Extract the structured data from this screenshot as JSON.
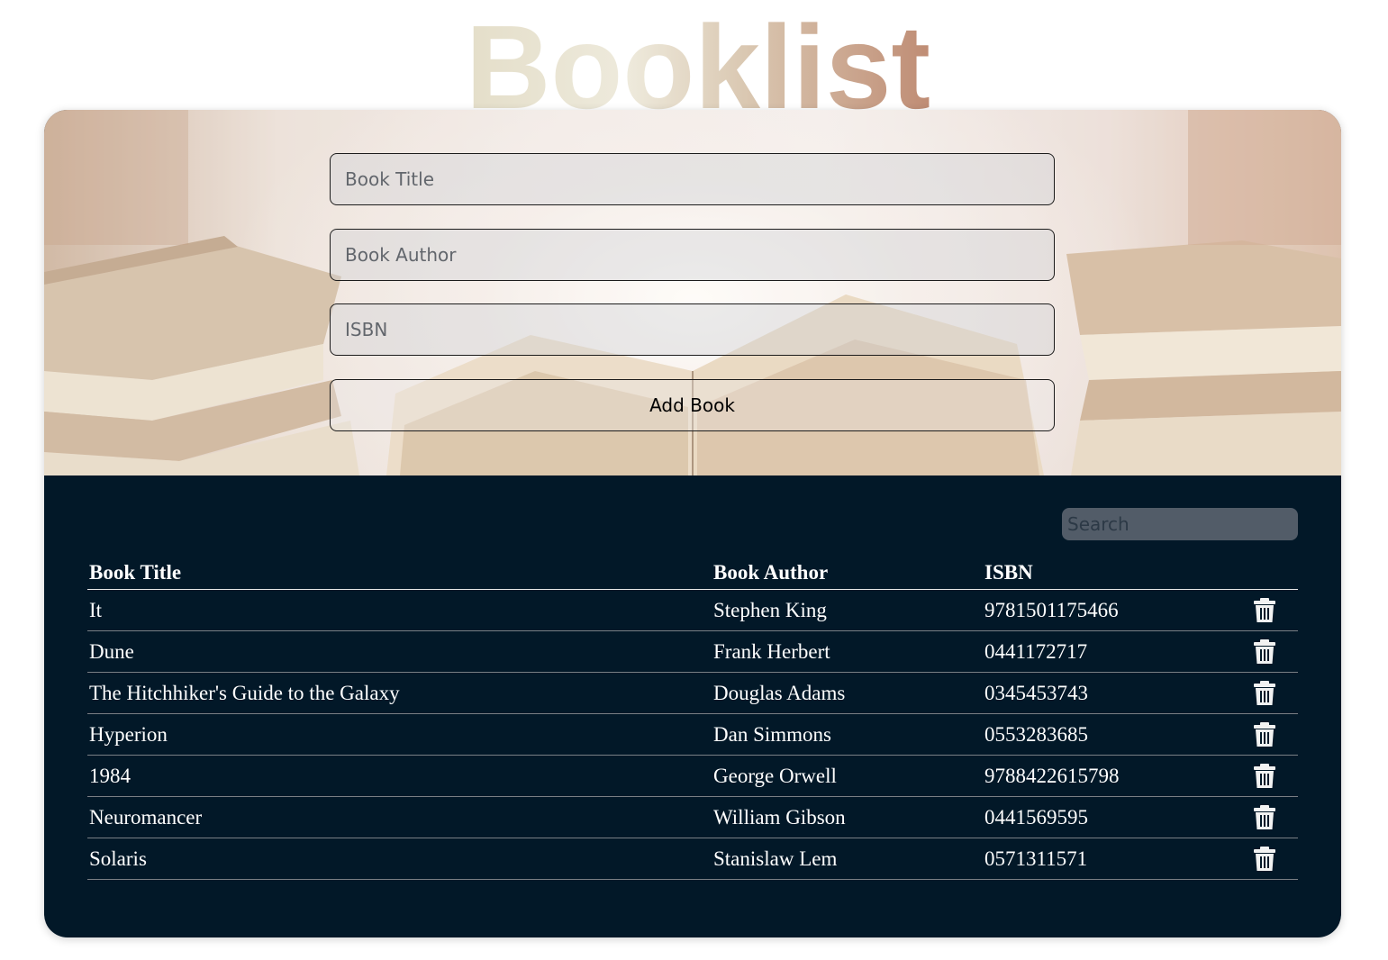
{
  "app": {
    "logo_text": "Booklist"
  },
  "form": {
    "title_placeholder": "Book Title",
    "author_placeholder": "Book Author",
    "isbn_placeholder": "ISBN",
    "title_value": "",
    "author_value": "",
    "isbn_value": "",
    "submit_label": "Add Book"
  },
  "search": {
    "placeholder": "Search",
    "value": ""
  },
  "table": {
    "headers": {
      "title": "Book Title",
      "author": "Book Author",
      "isbn": "ISBN"
    },
    "rows": [
      {
        "title": "It",
        "author": "Stephen King",
        "isbn": "9781501175466",
        "action_icon": "trash-icon"
      },
      {
        "title": "Dune",
        "author": "Frank Herbert",
        "isbn": "0441172717",
        "action_icon": "trash-icon"
      },
      {
        "title": "The Hitchhiker's Guide to the Galaxy",
        "author": "Douglas Adams",
        "isbn": "0345453743",
        "action_icon": "trash-icon"
      },
      {
        "title": "Hyperion",
        "author": "Dan Simmons",
        "isbn": "0553283685",
        "action_icon": "trash-icon"
      },
      {
        "title": "1984",
        "author": "George Orwell",
        "isbn": "9788422615798",
        "action_icon": "trash-icon"
      },
      {
        "title": "Neuromancer",
        "author": "William Gibson",
        "isbn": "0441569595",
        "action_icon": "trash-icon"
      },
      {
        "title": "Solaris",
        "author": "Stanislaw Lem",
        "isbn": "0571311571",
        "action_icon": "trash-icon"
      }
    ]
  },
  "colors": {
    "panel_dark": "#021828",
    "logo_gradient_start": "#e6e0cf",
    "logo_gradient_end": "#c08f78",
    "search_bg": "#525c68"
  }
}
